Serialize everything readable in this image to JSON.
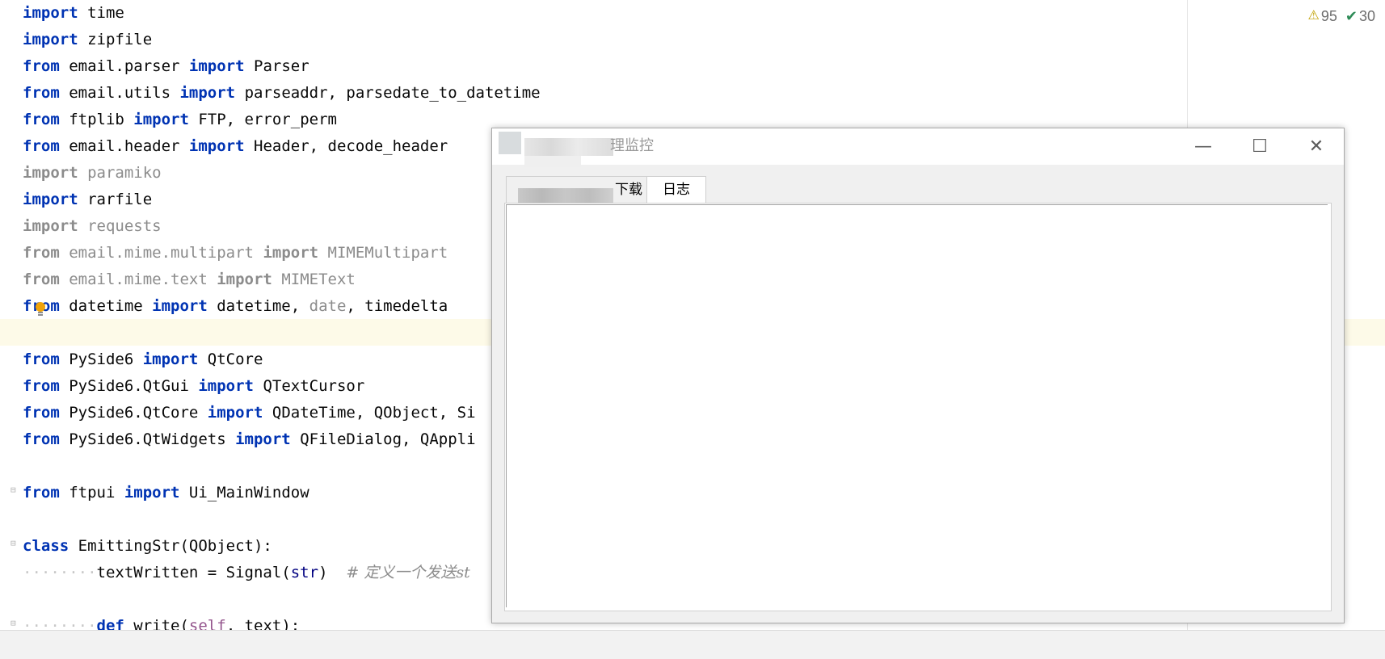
{
  "editor": {
    "lines": [
      {
        "a": "import",
        "b": " time"
      },
      {
        "a": "import",
        "b": " zipfile"
      },
      {
        "a": "from",
        "b": " email.parser ",
        "c": "import",
        "d": " Parser"
      },
      {
        "a": "from",
        "b": " email.utils ",
        "c": "import",
        "d": " parseaddr, parsedate_to_datetime"
      },
      {
        "a": "from",
        "b": " ftplib ",
        "c": "import",
        "d": " FTP, error_perm"
      },
      {
        "a": "from",
        "b": " email.header ",
        "c": "import",
        "d": " Header, decode_header"
      },
      {
        "a": "import",
        "b": " paramiko"
      },
      {
        "a": "import",
        "b": " rarfile"
      },
      {
        "a": "import",
        "b": " requests"
      },
      {
        "a": "from",
        "b": " email.mime.multipart ",
        "c": "import",
        "d": " MIMEMultipart"
      },
      {
        "a": "from",
        "b": " email.mime.text ",
        "c": "import",
        "d": " MIMEText"
      },
      {
        "a": "from",
        "b": " datetime ",
        "c": "import",
        "d": " datetime, ",
        "e": "date",
        "f": ", timedelta"
      },
      {
        "a": "from",
        "b": " PySide6 ",
        "c": "import",
        "d": " QtCore"
      },
      {
        "a": "from",
        "b": " PySide6.QtGui ",
        "c": "import",
        "d": " QTextCursor"
      },
      {
        "a": "from",
        "b": " PySide6.QtCore ",
        "c": "import",
        "d": " QDateTime, QObject, Si"
      },
      {
        "a": "from",
        "b": " PySide6.QtWidgets ",
        "c": "import",
        "d": " QFileDialog, QAppli"
      },
      {
        "a": "from",
        "b": " ftpui ",
        "c": "import",
        "d": " Ui_MainWindow"
      },
      {
        "a": "class",
        "b": " EmittingStr(QObject):"
      },
      {
        "indent": "········",
        "b": "textWritten = Signal(",
        "c": "str",
        "d": ")  ",
        "e": "# 定义一个发送st"
      },
      {
        "indent": "········",
        "a": "def",
        "b": " write(",
        "c": "self",
        "d": ", text):"
      }
    ]
  },
  "inspections": {
    "warnings": "95",
    "weak_warnings": "30"
  },
  "window": {
    "title": "理监控",
    "minimize": "—",
    "maximize": "☐",
    "close": "✕"
  },
  "tabs": [
    {
      "label": "下载"
    },
    {
      "label": "日志"
    }
  ]
}
